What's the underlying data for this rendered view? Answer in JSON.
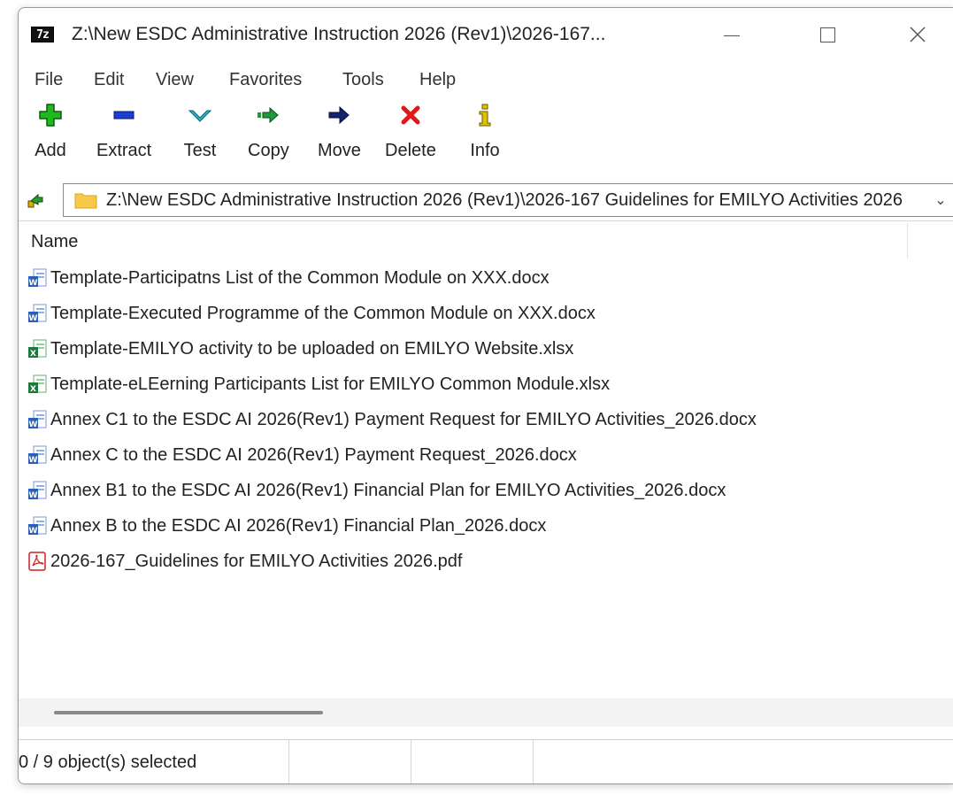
{
  "window": {
    "title": "Z:\\New ESDC Administrative Instruction 2026 (Rev1)\\2026-167...",
    "app_icon_text": "7z",
    "controls": {
      "minimize": "minimize-icon",
      "maximize": "maximize-icon",
      "close": "close-icon"
    }
  },
  "menu": [
    "File",
    "Edit",
    "View",
    "Favorites",
    "Tools",
    "Help"
  ],
  "toolbar": [
    {
      "label": "Add",
      "icon": "add-icon",
      "color": "#1fb81f"
    },
    {
      "label": "Extract",
      "icon": "extract-icon",
      "color": "#1b3fd0"
    },
    {
      "label": "Test",
      "icon": "test-icon",
      "color": "#22b8c8"
    },
    {
      "label": "Copy",
      "icon": "copy-icon",
      "color": "#1e9a3a"
    },
    {
      "label": "Move",
      "icon": "move-icon",
      "color": "#13236e"
    },
    {
      "label": "Delete",
      "icon": "delete-icon",
      "color": "#e01818"
    },
    {
      "label": "Info",
      "icon": "info-icon",
      "color": "#c8a800"
    }
  ],
  "address": {
    "path": "Z:\\New ESDC Administrative Instruction 2026 (Rev1)\\2026-167 Guidelines for EMILYO Activities 2026"
  },
  "list": {
    "column_name": "Name",
    "files": [
      {
        "name": "Template-Participatns List of the Common Module on XXX.docx",
        "type": "word"
      },
      {
        "name": "Template-Executed Programme of the Common Module on XXX.docx",
        "type": "word"
      },
      {
        "name": "Template-EMILYO activity to be uploaded on EMILYO Website.xlsx",
        "type": "excel"
      },
      {
        "name": "Template-eLEerning Participants List for EMILYO Common Module.xlsx",
        "type": "excel"
      },
      {
        "name": "Annex C1 to the ESDC AI 2026(Rev1) Payment Request for EMILYO Activities_2026.docx",
        "type": "word"
      },
      {
        "name": "Annex C to the ESDC AI 2026(Rev1) Payment Request_2026.docx",
        "type": "word"
      },
      {
        "name": "Annex B1 to the ESDC AI 2026(Rev1) Financial Plan for EMILYO Activities_2026.docx",
        "type": "word"
      },
      {
        "name": "Annex B to the ESDC AI 2026(Rev1) Financial Plan_2026.docx",
        "type": "word"
      },
      {
        "name": "2026-167_Guidelines for EMILYO Activities 2026.pdf",
        "type": "pdf"
      }
    ]
  },
  "status": {
    "selection": "0 / 9 object(s) selected"
  }
}
